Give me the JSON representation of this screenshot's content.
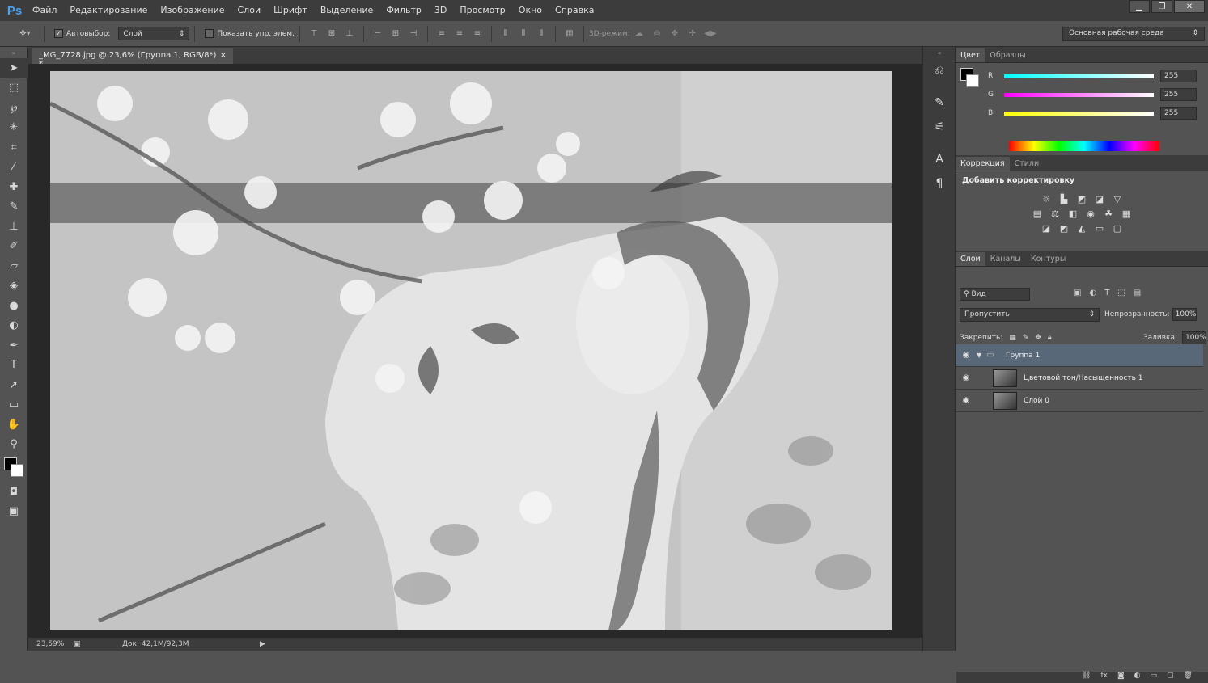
{
  "app": {
    "logo": "Ps"
  },
  "menu": [
    "Файл",
    "Редактирование",
    "Изображение",
    "Слои",
    "Шрифт",
    "Выделение",
    "Фильтр",
    "3D",
    "Просмотр",
    "Окно",
    "Справка"
  ],
  "window_controls": {
    "minimize": "▁",
    "restore": "❐",
    "close": "✕"
  },
  "options": {
    "autoselect_label": "Автовыбор:",
    "autoselect_value": "Слой",
    "show_controls_label": "Показать упр. элем.",
    "mode_3d_label": "3D-режим:",
    "workspace": "Основная рабочая среда"
  },
  "document": {
    "tab_title": "_MG_7728.jpg @ 23,6% (Группа 1, RGB/8*) *",
    "tab_close": "×",
    "zoom": "23,59%",
    "doc_size": "Док: 42,1M/92,3M"
  },
  "color_panel": {
    "tabs": [
      "Цвет",
      "Образцы"
    ],
    "r_label": "R",
    "r_value": "255",
    "g_label": "G",
    "g_value": "255",
    "b_label": "B",
    "b_value": "255"
  },
  "adjustments_panel": {
    "tabs": [
      "Коррекция",
      "Стили"
    ],
    "title": "Добавить корректировку"
  },
  "layers_panel": {
    "tabs": [
      "Слои",
      "Каналы",
      "Контуры"
    ],
    "filter": "Вид",
    "blend_mode": "Пропустить",
    "opacity_label": "Непрозрачность:",
    "opacity_value": "100%",
    "lock_label": "Закрепить:",
    "fill_label": "Заливка:",
    "fill_value": "100%",
    "layers": [
      {
        "name": "Группа 1",
        "type": "group",
        "selected": true
      },
      {
        "name": "Цветовой тон/Насыщенность 1",
        "type": "adjustment",
        "selected": false
      },
      {
        "name": "Слой 0",
        "type": "image",
        "selected": false
      }
    ],
    "footer_icons": [
      "link-icon",
      "fx-icon",
      "mask-icon",
      "adjustment-icon",
      "folder-icon",
      "new-layer-icon",
      "trash-icon"
    ]
  },
  "colors": {
    "menu_bg": "#3c3c3c",
    "panel_bg": "#535353",
    "selection": "#596878",
    "logo": "#4aa3f0"
  }
}
